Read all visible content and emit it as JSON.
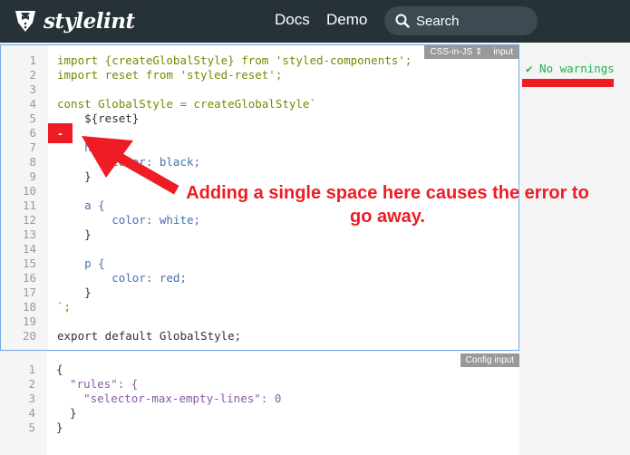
{
  "app": {
    "logo_text": "stylelint"
  },
  "nav": {
    "docs": "Docs",
    "demo": "Demo",
    "search_placeholder": "Search"
  },
  "editor": {
    "mode_label": "CSS-in-JS",
    "input_label": "input",
    "lines": [
      {
        "n": "1",
        "text": "import {createGlobalStyle} from 'styled-components';"
      },
      {
        "n": "2",
        "text": "import reset from 'styled-reset';"
      },
      {
        "n": "3",
        "text": ""
      },
      {
        "n": "4",
        "text": "const GlobalStyle = createGlobalStyle`"
      },
      {
        "n": "5",
        "text": "    ${reset}"
      },
      {
        "n": "6",
        "text": ""
      },
      {
        "n": "7",
        "text": "    h1 {"
      },
      {
        "n": "8",
        "text": "        color: black;"
      },
      {
        "n": "9",
        "text": "    }"
      },
      {
        "n": "10",
        "text": ""
      },
      {
        "n": "11",
        "text": "    a {"
      },
      {
        "n": "12",
        "text": "        color: white;"
      },
      {
        "n": "13",
        "text": "    }"
      },
      {
        "n": "14",
        "text": ""
      },
      {
        "n": "15",
        "text": "    p {"
      },
      {
        "n": "16",
        "text": "        color: red;"
      },
      {
        "n": "17",
        "text": "    }"
      },
      {
        "n": "18",
        "text": "`;"
      },
      {
        "n": "19",
        "text": ""
      },
      {
        "n": "20",
        "text": "export default GlobalStyle;"
      }
    ]
  },
  "config": {
    "label": "Config input",
    "lines": [
      {
        "n": "1",
        "text": "{"
      },
      {
        "n": "2",
        "text": "  \"rules\": {"
      },
      {
        "n": "3",
        "text": "    \"selector-max-empty-lines\": 0"
      },
      {
        "n": "4",
        "text": "  }"
      },
      {
        "n": "5",
        "text": "}"
      }
    ]
  },
  "results": {
    "status": "✔ No warnings"
  },
  "annotation": {
    "text": "Adding a single space here causes the error to go away.",
    "marker": "-"
  },
  "colors": {
    "header": "#263238",
    "accent_red": "#ee1c24",
    "ok_green": "#22b14c",
    "editor_border": "#73a9e6"
  }
}
